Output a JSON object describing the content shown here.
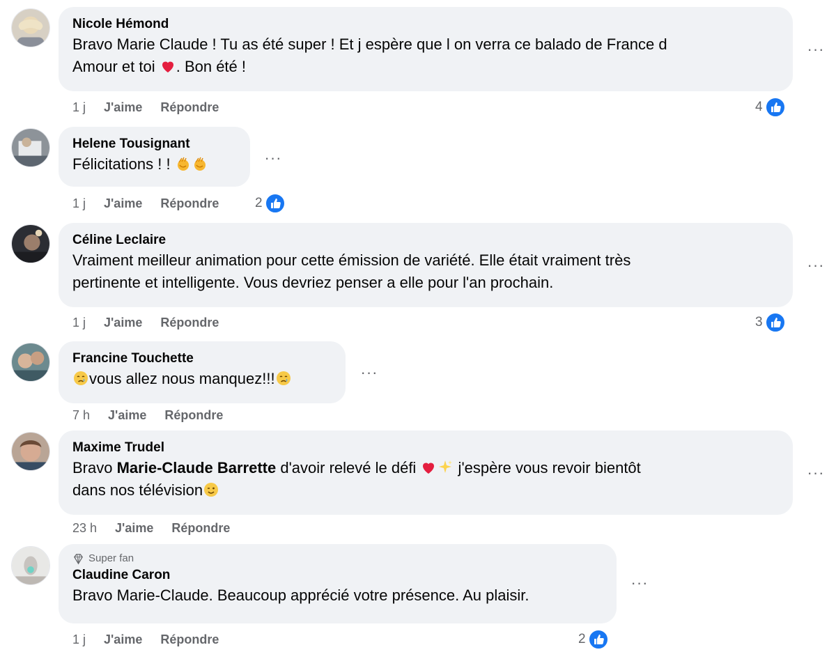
{
  "comments": [
    {
      "author": "Nicole Hémond",
      "text_line1_prefix": "Bravo Marie Claude ! Tu as été super ! Et j espère que l on verra ce balado de France d",
      "text_line2_prefix": "Amour et toi ",
      "text_line2_suffix": ". Bon été !",
      "time": "1 j",
      "like_label": "J'aime",
      "reply_label": "Répondre",
      "reaction_count": "4",
      "more_label": "···"
    },
    {
      "author": "Helene Tousignant",
      "text_prefix": "Félicitations ! ! ",
      "time": "1 j",
      "like_label": "J'aime",
      "reply_label": "Répondre",
      "reaction_count": "2",
      "more_label": "···"
    },
    {
      "author": "Céline Leclaire",
      "text_line1": "Vraiment meilleur animation pour cette émission de variété. Elle était vraiment très",
      "text_line2": "pertinente et intelligente. Vous devriez penser a elle pour l'an prochain.",
      "time": "1 j",
      "like_label": "J'aime",
      "reply_label": "Répondre",
      "reaction_count": "3",
      "more_label": "···"
    },
    {
      "author": "Francine Touchette",
      "text_middle": "vous allez nous manquez!!!",
      "time": "7 h",
      "like_label": "J'aime",
      "reply_label": "Répondre",
      "more_label": "···"
    },
    {
      "author": "Maxime Trudel",
      "text_line1_prefix": "Bravo ",
      "mention": "Marie-Claude Barrette",
      "text_line1_middle": " d'avoir relevé le défi ",
      "text_line1_suffix": " j'espère vous revoir bientôt",
      "text_line2_prefix": "dans nos télévision",
      "time": "23 h",
      "like_label": "J'aime",
      "reply_label": "Répondre",
      "more_label": "···"
    },
    {
      "badge": "Super fan",
      "author": "Claudine Caron",
      "text": "Bravo Marie-Claude. Beaucoup apprécié votre présence. Au plaisir.",
      "time": "1 j",
      "like_label": "J'aime",
      "reply_label": "Répondre",
      "reaction_count": "2",
      "more_label": "···"
    }
  ],
  "icons": {
    "like": "like-thumb-icon",
    "heart": "heart-emoji-icon",
    "clap": "clapping-hands-emoji-icon",
    "crying": "crying-face-emoji-icon",
    "sparkles": "sparkles-emoji-icon",
    "wink": "winking-face-emoji-icon",
    "diamond": "diamond-icon",
    "more": "more-options-icon"
  },
  "colors": {
    "like_blue": "#1877f2",
    "bubble_bg": "#f0f2f5",
    "meta_gray": "#65676b",
    "heart_red": "#e41e3f"
  }
}
